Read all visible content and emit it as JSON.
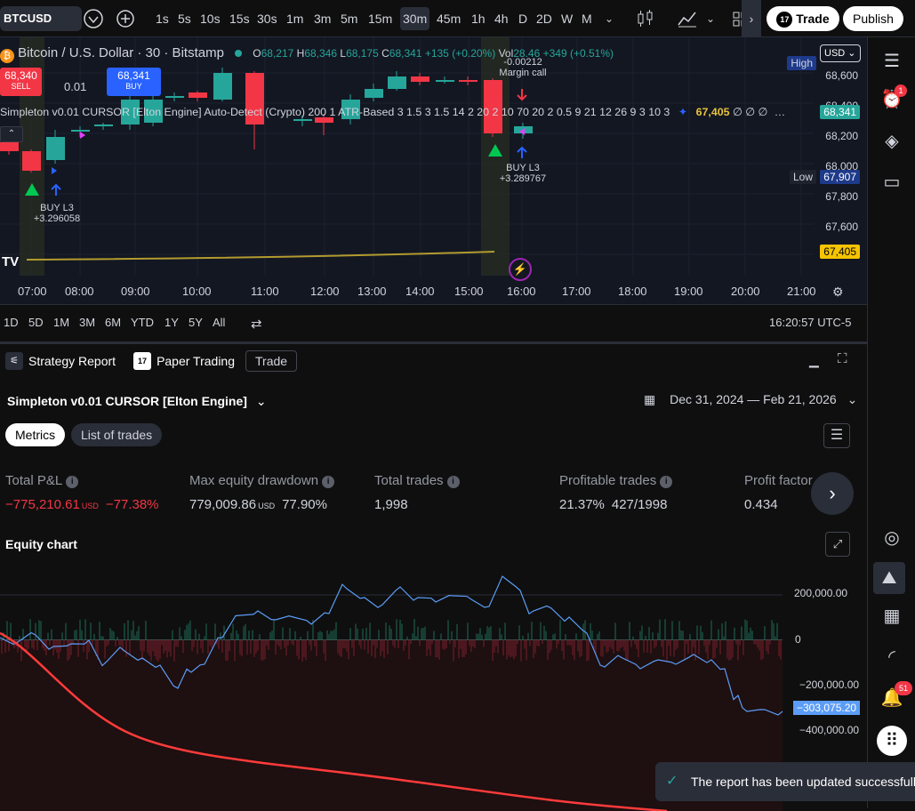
{
  "topbar": {
    "symbol": "BTCUSD",
    "timeframes": [
      "1s",
      "5s",
      "10s",
      "15s",
      "30s",
      "1m",
      "3m",
      "5m",
      "15m",
      "30m",
      "45m",
      "1h",
      "4h",
      "D",
      "2D",
      "W",
      "M"
    ],
    "active_timeframe": "30m",
    "trade_label": "Trade",
    "publish_label": "Publish"
  },
  "chart": {
    "title": "Bitcoin / U.S. Dollar · 30 · Bitstamp",
    "ohlc": {
      "o_lbl": "O",
      "o": "68,217",
      "h_lbl": "H",
      "h": "68,346",
      "l_lbl": "L",
      "l": "68,175",
      "c_lbl": "C",
      "c": "68,341",
      "change": "+135 (+0.20%)",
      "vol_lbl": "Vol",
      "vol": "28.46",
      "vol_change": "+349 (+0.51%)"
    },
    "sell_price": "68,340",
    "sell_label": "SELL",
    "spread": "0.01",
    "buy_price": "68,341",
    "buy_label": "BUY",
    "indicator_line": "Simpleton v0.01 CURSOR [Elton Engine] Auto-Detect (Crypto) 200 1 ATR-Based 3 1.5 3 1.5 14 2 20 2 10 70 20 2 0.5 9 21 12 26 9 3 10 3",
    "indicator_value": "67,405",
    "indicator_tail": "∅ ∅ ∅",
    "currency": "USD",
    "high_label": "High",
    "low_label": "Low",
    "low_value": "67,907",
    "last_price": "68,341",
    "ma_value": "67,405",
    "yaxis": [
      "68,600",
      "68,400",
      "68,200",
      "68,000",
      "67,800",
      "67,600"
    ],
    "xaxis": [
      "07:00",
      "08:00",
      "09:00",
      "10:00",
      "11:00",
      "12:00",
      "13:00",
      "14:00",
      "15:00",
      "16:00",
      "17:00",
      "18:00",
      "19:00",
      "20:00",
      "21:00"
    ],
    "ann1_label": "BUY L3",
    "ann1_value": "+3.296058",
    "ann2_label": "BUY L3",
    "ann2_value": "+3.289767",
    "margin_value": "-0.00212",
    "margin_label": "Margin call"
  },
  "rangebar": {
    "ranges": [
      "1D",
      "5D",
      "1M",
      "3M",
      "6M",
      "YTD",
      "1Y",
      "5Y",
      "All"
    ],
    "clock": "16:20:57 UTC-5"
  },
  "panel": {
    "tabs": [
      "Strategy Report",
      "Paper Trading",
      "Trade"
    ],
    "strategy_name": "Simpleton v0.01 CURSOR [Elton Engine]",
    "date_range": "Dec 31, 2024 — Feb 21, 2026",
    "subtabs": [
      "Metrics",
      "List of trades"
    ],
    "metrics": [
      {
        "label": "Total P&L",
        "value": "−775,210.61",
        "unit": "USD",
        "extra": "−77.38%",
        "neg": true
      },
      {
        "label": "Max equity drawdown",
        "value": "779,009.86",
        "unit": "USD",
        "extra": "77.90%",
        "neg": false
      },
      {
        "label": "Total trades",
        "value": "1,998",
        "unit": "",
        "extra": "",
        "neg": false
      },
      {
        "label": "Profitable trades",
        "value": "21.37%",
        "unit": "",
        "extra": "427/1998",
        "neg": false
      },
      {
        "label": "Profit factor",
        "value": "0.434",
        "unit": "",
        "extra": "",
        "neg": false
      }
    ],
    "equity_title": "Equity chart",
    "equity_axis": [
      "200,000.00",
      "0",
      "−200,000.00",
      "−400,000.00"
    ],
    "equity_last": "−303,075.20",
    "toast": "The report has been updated successfully"
  },
  "rightbar": {
    "alerts_badge": "1",
    "notif_badge": "51"
  },
  "colors": {
    "up": "#26a69a",
    "down": "#f23645",
    "accent": "#2962ff",
    "ma": "#b39b2e",
    "equity": "#5b9cf6",
    "drawdown": "#ff3b3b"
  }
}
